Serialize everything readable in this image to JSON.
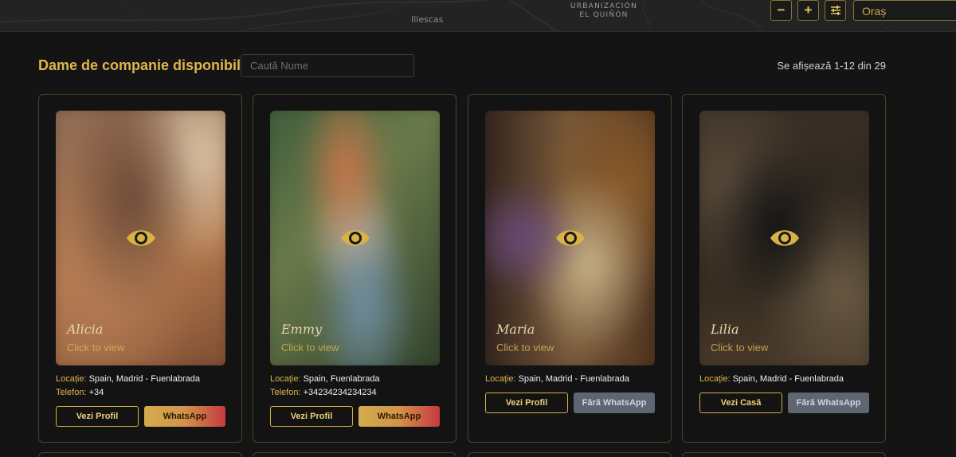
{
  "map": {
    "labels": {
      "town": "Illescas",
      "area_line1": "URBANIZACIÓN",
      "area_line2": "EL QUIÑÓN"
    },
    "controls": {
      "zoom_out": "−",
      "zoom_in": "+",
      "city_placeholder": "Oraș"
    }
  },
  "header": {
    "title": "Dame de companie disponibile",
    "search_placeholder": "Caută Nume",
    "count": "Se afișează 1-12 din 29"
  },
  "labels": {
    "location": "Locație:",
    "phone": "Telefon:",
    "click_to_view": "Click to view"
  },
  "cards": [
    {
      "name": "Alicia",
      "location": "Spain, Madrid - Fuenlabrada",
      "phone": "+34",
      "primary": "Vezi Profil",
      "secondary": "WhatsApp",
      "has_whatsapp": true
    },
    {
      "name": "Emmy",
      "location": "Spain, Fuenlabrada",
      "phone": "+34234234234234",
      "primary": "Vezi Profil",
      "secondary": "WhatsApp",
      "has_whatsapp": true
    },
    {
      "name": "Maria",
      "location": "Spain, Madrid - Fuenlabrada",
      "phone": "",
      "primary": "Vezi Profil",
      "secondary": "Fără WhatsApp",
      "has_whatsapp": false
    },
    {
      "name": "Lilia",
      "location": "Spain, Madrid - Fuenlabrada",
      "phone": "",
      "primary": "Vezi Casă",
      "secondary": "Fără WhatsApp",
      "has_whatsapp": false
    }
  ],
  "colors": {
    "accent": "#e0b54c",
    "card_border": "#4b4226",
    "background": "#141414"
  }
}
